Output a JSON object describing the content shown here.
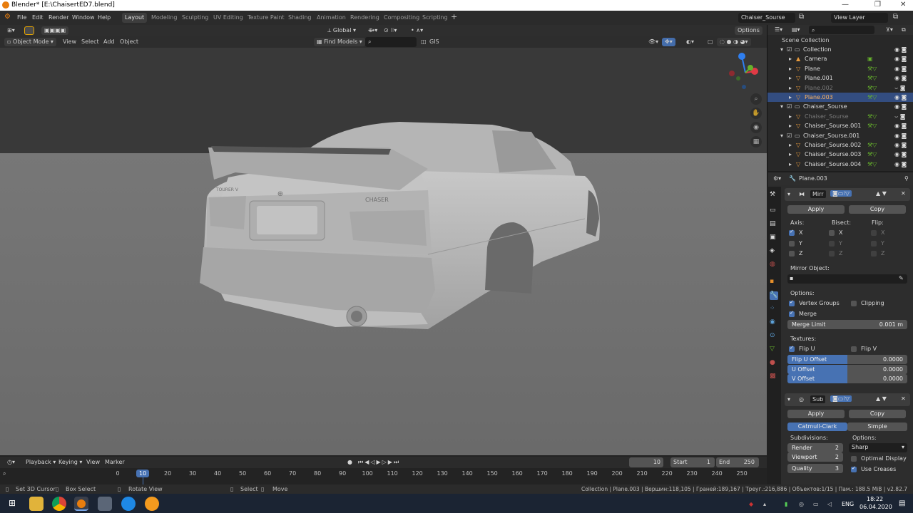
{
  "window": {
    "title": "Blender* [E:\\ChaisertED7.blend]",
    "controls": [
      "—",
      "❐",
      "✕"
    ]
  },
  "menus": [
    "File",
    "Edit",
    "Render",
    "Window",
    "Help"
  ],
  "workspaces": [
    "Layout",
    "Modeling",
    "Sculpting",
    "UV Editing",
    "Texture Paint",
    "Shading",
    "Animation",
    "Rendering",
    "Compositing",
    "Scripting"
  ],
  "active_workspace": "Layout",
  "scene": {
    "name": "Chaiser_Sourse",
    "view_layer": "View Layer"
  },
  "viewport_header": {
    "transform_orientation": "Global",
    "options_label": "Options",
    "mode": "Object Mode",
    "menus": [
      "View",
      "Select",
      "Add",
      "Object"
    ],
    "find_models": "Find Models",
    "gis": "GIS"
  },
  "outliner": {
    "title": "Scene Collection",
    "items": [
      {
        "label": "Collection",
        "indent": 1,
        "kind": "collection",
        "active": false,
        "dim": false
      },
      {
        "label": "Camera",
        "indent": 2,
        "kind": "camera",
        "active": false,
        "dim": false
      },
      {
        "label": "Plane",
        "indent": 2,
        "kind": "mesh",
        "active": false,
        "dim": false
      },
      {
        "label": "Plane.001",
        "indent": 2,
        "kind": "mesh",
        "active": false,
        "dim": false
      },
      {
        "label": "Plane.002",
        "indent": 2,
        "kind": "mesh",
        "active": false,
        "dim": true
      },
      {
        "label": "Plane.003",
        "indent": 2,
        "kind": "mesh",
        "active": true,
        "dim": false
      },
      {
        "label": "Chaiser_Sourse",
        "indent": 1,
        "kind": "collection",
        "active": false,
        "dim": false
      },
      {
        "label": "Chaiser_Sourse",
        "indent": 2,
        "kind": "mesh",
        "active": false,
        "dim": true
      },
      {
        "label": "Chaiser_Sourse.001",
        "indent": 2,
        "kind": "mesh",
        "active": false,
        "dim": false
      },
      {
        "label": "Chaiser_Sourse.001",
        "indent": 1,
        "kind": "collection",
        "active": false,
        "dim": false
      },
      {
        "label": "Chaiser_Sourse.002",
        "indent": 2,
        "kind": "mesh",
        "active": false,
        "dim": false
      },
      {
        "label": "Chaiser_Sourse.003",
        "indent": 2,
        "kind": "mesh",
        "active": false,
        "dim": false
      },
      {
        "label": "Chaiser_Sourse.004",
        "indent": 2,
        "kind": "mesh",
        "active": false,
        "dim": false
      }
    ]
  },
  "properties": {
    "object_name": "Plane.003",
    "mirror": {
      "name": "Mirr",
      "apply": "Apply",
      "copy": "Copy",
      "axis_label": "Axis:",
      "bisect_label": "Bisect:",
      "flip_label": "Flip:",
      "axes": [
        "X",
        "Y",
        "Z"
      ],
      "axis_checked": [
        true,
        false,
        false
      ],
      "mirror_object_label": "Mirror Object:",
      "options_label": "Options:",
      "vertex_groups": "Vertex Groups",
      "clipping": "Clipping",
      "merge": "Merge",
      "merge_limit_label": "Merge Limit",
      "merge_limit": "0.001 m",
      "textures_label": "Textures:",
      "flip_u": "Flip U",
      "flip_v": "Flip V",
      "flip_u_offset_label": "Flip U Offset",
      "flip_u_offset": "0.0000",
      "u_offset_label": "U Offset",
      "u_offset": "0.0000",
      "v_offset_label": "V Offset",
      "v_offset": "0.0000"
    },
    "subsurf": {
      "name": "Sub",
      "apply": "Apply",
      "copy": "Copy",
      "catmull": "Catmull-Clark",
      "simple": "Simple",
      "subdivisions_label": "Subdivisions:",
      "options_label": "Options:",
      "render_label": "Render",
      "render": "2",
      "viewport_label": "Viewport",
      "viewport": "2",
      "quality_label": "Quality",
      "quality": "3",
      "uv_smooth": "Sharp",
      "optimal_display": "Optimal Display",
      "use_creases": "Use Creases"
    }
  },
  "timeline": {
    "menus": [
      "Playback",
      "Keying",
      "View",
      "Marker"
    ],
    "current_frame": "10",
    "start_label": "Start",
    "start": "1",
    "end_label": "End",
    "end": "250",
    "ticks": [
      "0",
      "10",
      "20",
      "30",
      "40",
      "50",
      "60",
      "70",
      "80",
      "90",
      "100",
      "110",
      "120",
      "130",
      "140",
      "150",
      "160",
      "170",
      "180",
      "190",
      "200",
      "210",
      "220",
      "230",
      "240",
      "250"
    ]
  },
  "statusbar": {
    "hints": [
      "Set 3D Cursor",
      "Box Select",
      "Rotate View",
      "Select",
      "Move"
    ],
    "info": "Collection | Plane.003 | Вершин:118,105 | Граней:189,167 | Треуг.:216,886 | Объектов:1/15 | Пам.: 188.5 MiB | v2.82.7"
  },
  "taskbar": {
    "lang": "ENG",
    "time": "18:22",
    "date": "06.04.2020"
  },
  "car": {
    "badge": "CHASER",
    "model_badge": "TOURER V"
  },
  "colors": {
    "accent": "#4772b3",
    "active_ws": "#3d3d3d",
    "sky": "#393939",
    "ground": "#6c6c6c",
    "car": "#b8b8b8"
  }
}
